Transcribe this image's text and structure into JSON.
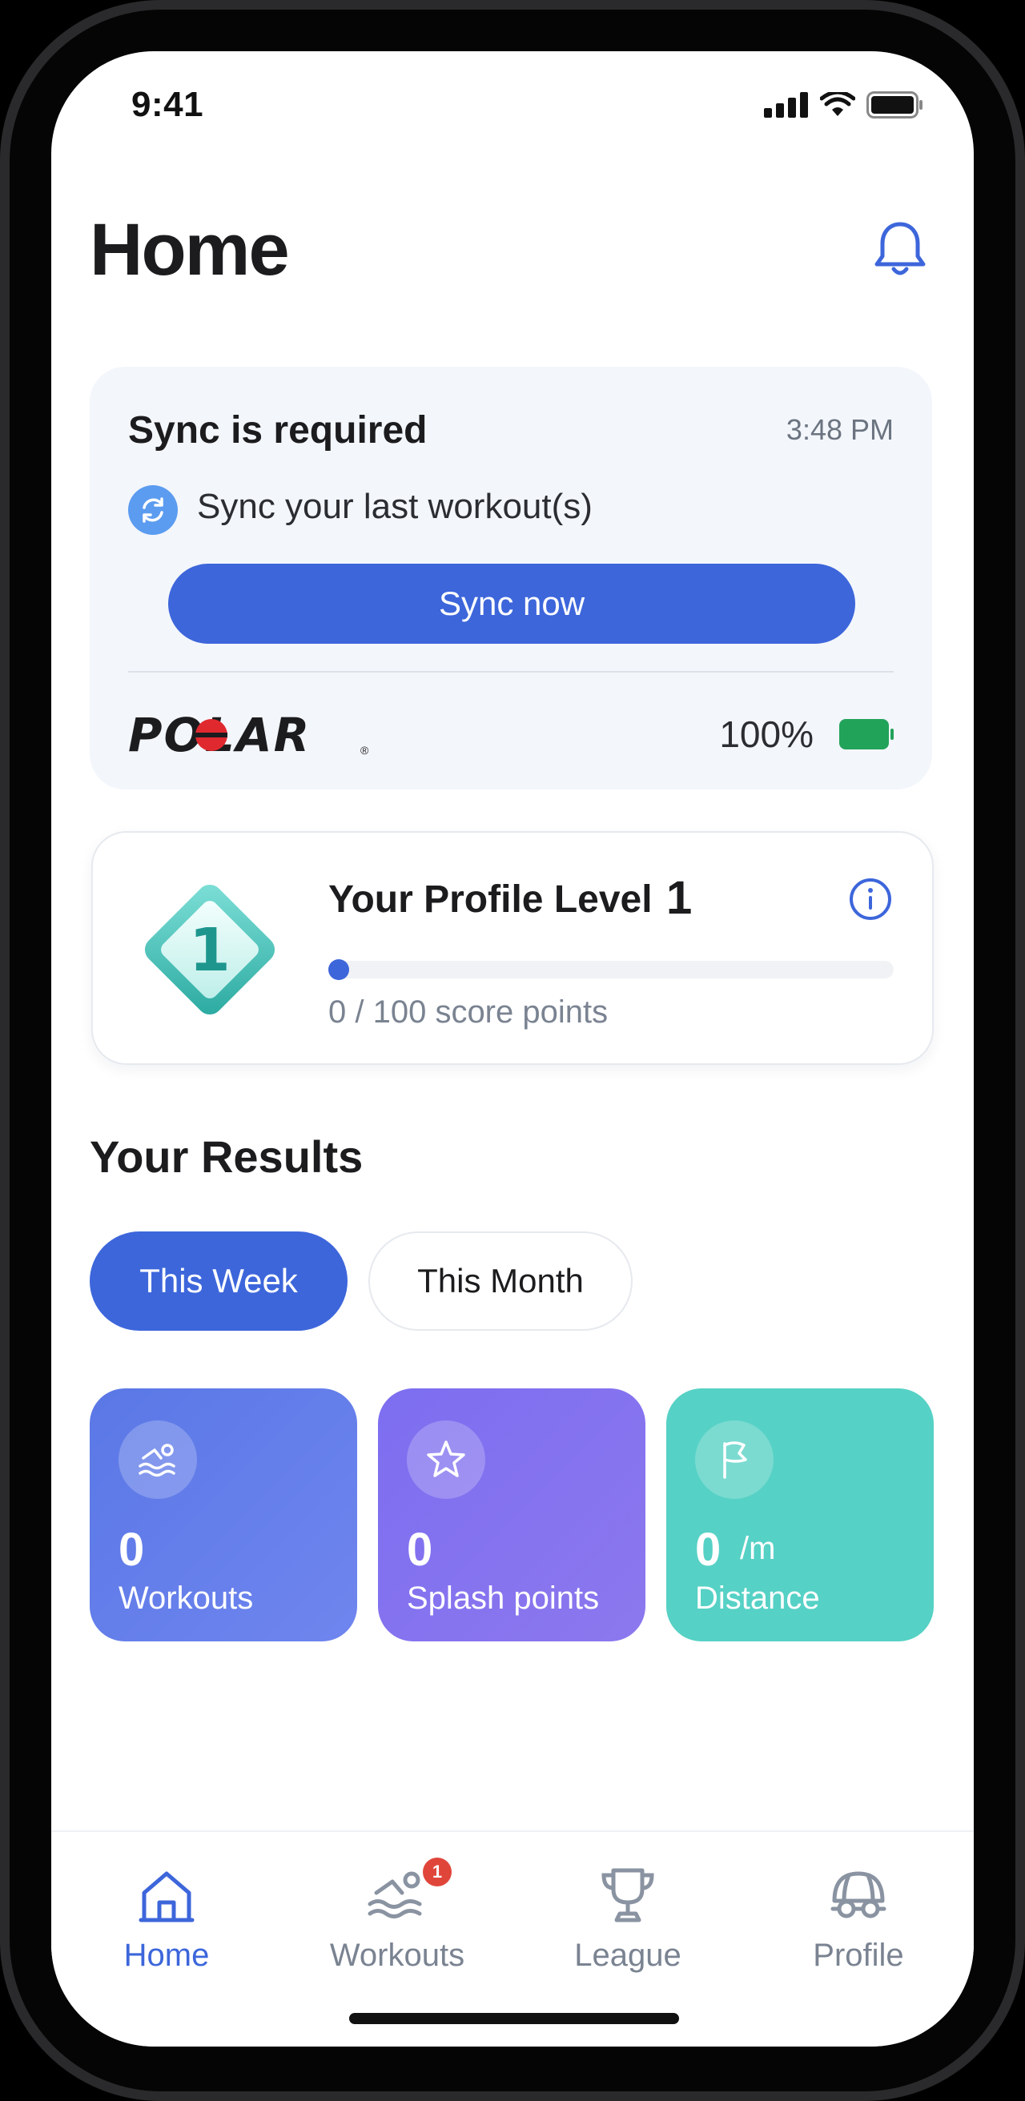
{
  "status_bar": {
    "time": "9:41",
    "icons": [
      "signal-icon",
      "wifi-icon",
      "battery-icon"
    ]
  },
  "header": {
    "title": "Home",
    "notification_icon": "bell-icon"
  },
  "sync_card": {
    "title": "Sync is required",
    "time": "3:48 PM",
    "icon": "sync-icon",
    "subtitle": "Sync your last workout(s)",
    "button_label": "Sync now",
    "brand": "POLAR",
    "battery_percent_label": "100%",
    "battery_level": 1.0,
    "battery_color": "#22a35a"
  },
  "profile_level": {
    "title": "Your Profile Level",
    "level": "1",
    "badge_number": "1",
    "points_label": "0 / 100 score points",
    "progress": 0.0,
    "info_icon": "info-icon"
  },
  "results": {
    "title": "Your Results",
    "tabs": [
      {
        "label": "This Week",
        "selected": true
      },
      {
        "label": "This Month",
        "selected": false
      }
    ],
    "stats": [
      {
        "value": "0",
        "unit": "",
        "label": "Workouts",
        "icon": "swimmer-icon",
        "color": "#5f7ce8"
      },
      {
        "value": "0",
        "unit": "",
        "label": "Splash points",
        "icon": "star-icon",
        "color": "#8475ef"
      },
      {
        "value": "0",
        "unit": "/m",
        "label": "Distance",
        "icon": "flag-icon",
        "color": "#56d1c5"
      }
    ]
  },
  "bottom_nav": {
    "items": [
      {
        "label": "Home",
        "icon": "home-icon",
        "active": true
      },
      {
        "label": "Workouts",
        "icon": "swimmer-icon",
        "active": false,
        "badge": "1"
      },
      {
        "label": "League",
        "icon": "trophy-icon",
        "active": false
      },
      {
        "label": "Profile",
        "icon": "swim-cap-icon",
        "active": false
      }
    ]
  },
  "colors": {
    "accent": "#3d66db",
    "card_bg": "#f3f6fb",
    "badge_red": "#e0453a",
    "teal": "#56d1c5"
  }
}
